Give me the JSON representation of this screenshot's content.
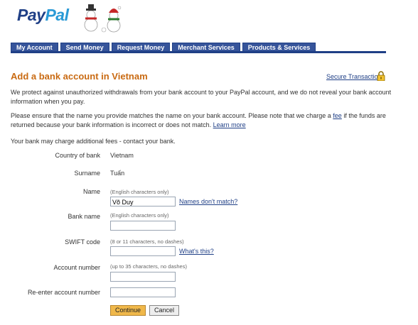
{
  "header": {
    "logo_pay": "Pay",
    "logo_pal": "Pal",
    "tabs": [
      "My Account",
      "Send Money",
      "Request Money",
      "Merchant Services",
      "Products & Services"
    ]
  },
  "page": {
    "title": "Add a bank account in Vietnam",
    "secure_link": "Secure Transaction",
    "p1": "We protect against unauthorized withdrawals from your bank account to your PayPal account, and we do not reveal your bank account information when you pay.",
    "p2_before": "Please ensure that the name you provide matches the name on your bank account. Please note that we charge a ",
    "p2_fee": "fee",
    "p2_after": " if the funds are returned because your bank information is incorrect or does not match. ",
    "p2_learn": "Learn more",
    "p3": "Your bank may charge additional fees - contact your bank."
  },
  "form": {
    "country_label": "Country of bank",
    "country_value": "Vietnam",
    "surname_label": "Surname",
    "surname_value": "Tuấn",
    "name_label": "Name",
    "name_hint": "(English characters only)",
    "name_value": "Võ Duy",
    "name_link": "Names don't match?",
    "bank_label": "Bank name",
    "bank_hint": "(English characters only)",
    "bank_value": "",
    "swift_label": "SWIFT code",
    "swift_hint": "(8 or 11 characters, no dashes)",
    "swift_value": "",
    "swift_link": "What's this?",
    "acct_label": "Account number",
    "acct_hint": "(up to 35 characters, no dashes)",
    "acct_value": "",
    "reacct_label": "Re-enter account number",
    "reacct_value": "",
    "continue_label": "Continue",
    "cancel_label": "Cancel"
  }
}
